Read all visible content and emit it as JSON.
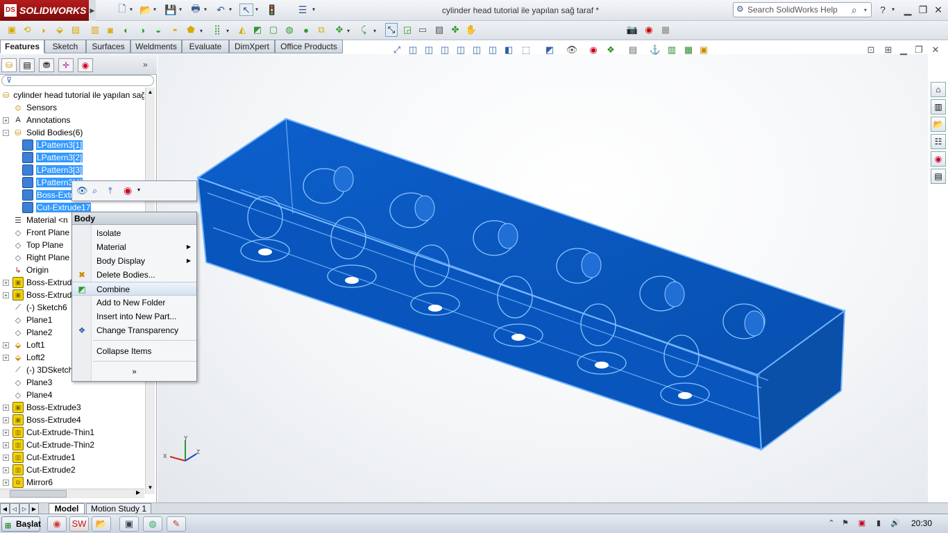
{
  "app": {
    "logo_text": "SOLIDWORKS",
    "logo_mark": "DS",
    "document_title": "cylinder head tutorial ile yapılan sağ taraf *",
    "search_placeholder": "Search SolidWorks Help"
  },
  "command_tabs": [
    "Features",
    "Sketch",
    "Surfaces",
    "Weldments",
    "Evaluate",
    "DimXpert",
    "Office Products"
  ],
  "active_command_tab": "Features",
  "feature_tree": {
    "root": "cylinder head tutorial ile yapılan sağ",
    "items": [
      {
        "label": "Sensors",
        "icon": "sensor-icon",
        "expand": false,
        "depth": 0
      },
      {
        "label": "Annotations",
        "icon": "annotations-icon",
        "expand": true,
        "depth": 0
      },
      {
        "label": "Solid Bodies(6)",
        "icon": "solid-bodies-folder-icon",
        "expand": true,
        "depth": 0,
        "expanded": true
      },
      {
        "label": "LPattern3[1]",
        "icon": "body-icon",
        "depth": 1,
        "selected": true
      },
      {
        "label": "LPattern3[2]",
        "icon": "body-icon",
        "depth": 1,
        "selected": true
      },
      {
        "label": "LPattern3[3]",
        "icon": "body-icon",
        "depth": 1,
        "selected": true
      },
      {
        "label": "LPattern3[4]",
        "icon": "body-icon",
        "depth": 1,
        "selected": true
      },
      {
        "label": "Boss-Extrude",
        "icon": "body-icon",
        "depth": 1,
        "selected": true
      },
      {
        "label": "Cut-Extrude17",
        "icon": "body-icon",
        "depth": 1,
        "selected": true
      },
      {
        "label": "Material <n",
        "icon": "material-icon",
        "depth": 0
      },
      {
        "label": "Front Plane",
        "icon": "plane-icon",
        "depth": 0
      },
      {
        "label": "Top Plane",
        "icon": "plane-icon",
        "depth": 0
      },
      {
        "label": "Right Plane",
        "icon": "plane-icon",
        "depth": 0
      },
      {
        "label": "Origin",
        "icon": "origin-icon",
        "depth": 0
      },
      {
        "label": "Boss-Extrude",
        "icon": "extrude-icon",
        "expand": true,
        "depth": 0
      },
      {
        "label": "Boss-Extrude",
        "icon": "extrude-icon",
        "expand": true,
        "depth": 0
      },
      {
        "label": "(-) Sketch6",
        "icon": "sketch-icon",
        "depth": 0
      },
      {
        "label": "Plane1",
        "icon": "plane-icon",
        "depth": 0
      },
      {
        "label": "Plane2",
        "icon": "plane-icon",
        "depth": 0
      },
      {
        "label": "Loft1",
        "icon": "loft-icon",
        "expand": true,
        "depth": 0
      },
      {
        "label": "Loft2",
        "icon": "loft-icon",
        "expand": true,
        "depth": 0
      },
      {
        "label": "(-) 3DSketch",
        "icon": "3dsketch-icon",
        "depth": 0
      },
      {
        "label": "Plane3",
        "icon": "plane-icon",
        "depth": 0
      },
      {
        "label": "Plane4",
        "icon": "plane-icon",
        "depth": 0
      },
      {
        "label": "Boss-Extrude3",
        "icon": "extrude-icon",
        "expand": true,
        "depth": 0
      },
      {
        "label": "Boss-Extrude4",
        "icon": "extrude-icon",
        "expand": true,
        "depth": 0
      },
      {
        "label": "Cut-Extrude-Thin1",
        "icon": "cut-extrude-icon",
        "expand": true,
        "depth": 0
      },
      {
        "label": "Cut-Extrude-Thin2",
        "icon": "cut-extrude-icon",
        "expand": true,
        "depth": 0
      },
      {
        "label": "Cut-Extrude1",
        "icon": "cut-extrude-icon",
        "expand": true,
        "depth": 0
      },
      {
        "label": "Cut-Extrude2",
        "icon": "cut-extrude-icon",
        "expand": true,
        "depth": 0
      },
      {
        "label": "Mirror6",
        "icon": "mirror-icon",
        "expand": true,
        "depth": 0
      }
    ]
  },
  "context_menu": {
    "header": "Body",
    "items": [
      {
        "label": "Isolate",
        "icon": "",
        "submenu": false
      },
      {
        "label": "Material",
        "icon": "",
        "submenu": true
      },
      {
        "label": "Body Display",
        "icon": "",
        "submenu": true
      },
      {
        "label": "Delete Bodies...",
        "icon": "delete-icon",
        "submenu": false
      },
      {
        "label": "Combine",
        "icon": "combine-icon",
        "submenu": false,
        "highlighted": true
      },
      {
        "label": "Add to New Folder",
        "icon": "",
        "submenu": false
      },
      {
        "label": "Insert into New Part...",
        "icon": "",
        "submenu": false
      },
      {
        "label": "Change Transparency",
        "icon": "transparency-icon",
        "submenu": false
      },
      {
        "label": "Collapse Items",
        "icon": "",
        "submenu": false
      }
    ],
    "more": "»"
  },
  "bottom_tabs": [
    "Model",
    "Motion Study 1"
  ],
  "active_bottom_tab": "Model",
  "triad": {
    "x": "X",
    "y": "Y",
    "z": "Z"
  },
  "taskbar": {
    "start_label": "Başlat",
    "clock": "20:30"
  },
  "colors": {
    "model_fill": "#0a5bc4",
    "model_edges": "#5fa6ff",
    "selection": "#3399ff",
    "highlight_yellow": "#f6d200"
  }
}
